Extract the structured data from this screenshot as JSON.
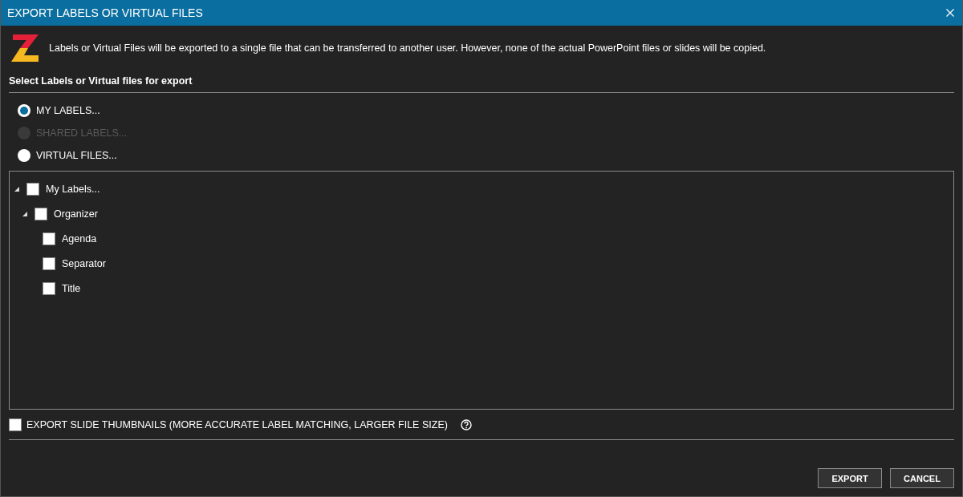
{
  "window": {
    "title": "EXPORT LABELS OR VIRTUAL FILES"
  },
  "intro": "Labels or Virtual Files will be exported to a single file that can be transferred to another user. However, none of the actual PowerPoint files or slides will be copied.",
  "section_title": "Select Labels or Virtual files for export",
  "sources": [
    {
      "label": "MY LABELS...",
      "selected": true,
      "disabled": false
    },
    {
      "label": "SHARED LABELS...",
      "selected": false,
      "disabled": true
    },
    {
      "label": "VIRTUAL FILES...",
      "selected": false,
      "disabled": false
    }
  ],
  "tree": [
    {
      "label": "My Labels...",
      "checked": false,
      "expanded": true,
      "children": [
        {
          "label": "Organizer",
          "checked": false,
          "expanded": true,
          "children": [
            {
              "label": "Agenda",
              "checked": false
            },
            {
              "label": "Separator",
              "checked": false
            },
            {
              "label": "Title",
              "checked": false
            }
          ]
        }
      ]
    }
  ],
  "thumbnails_option": {
    "label": "EXPORT SLIDE THUMBNAILS (MORE ACCURATE LABEL MATCHING, LARGER FILE SIZE)",
    "checked": false
  },
  "buttons": [
    "EXPORT",
    "CANCEL"
  ]
}
